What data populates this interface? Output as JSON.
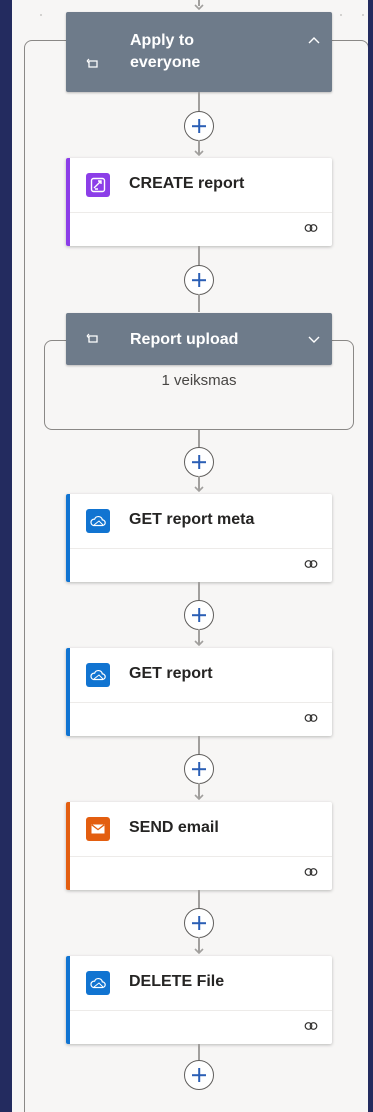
{
  "flow": {
    "apply_to_each": {
      "title_line1": "Apply to",
      "title_line2": "everyone"
    },
    "steps": [
      {
        "label": "CREATE report",
        "connector": "word-online",
        "accent": "#8c3ee8"
      },
      {
        "label": "GET report meta",
        "connector": "onedrive",
        "accent": "#1174d1"
      },
      {
        "label": "GET report",
        "connector": "onedrive",
        "accent": "#1174d1"
      },
      {
        "label": "SEND email",
        "connector": "outlook-mail",
        "accent": "#e35e10"
      },
      {
        "label": "DELETE File",
        "connector": "onedrive",
        "accent": "#1174d1"
      }
    ],
    "report_upload": {
      "title": "Report upload",
      "collapsed_summary": "1 veiksmas"
    }
  },
  "colors": {
    "loop_header": "#6e7b8a",
    "canvas": "#f7f6f5",
    "plus_icon": "#2b5fb5",
    "outer_background": "#232b5f"
  }
}
